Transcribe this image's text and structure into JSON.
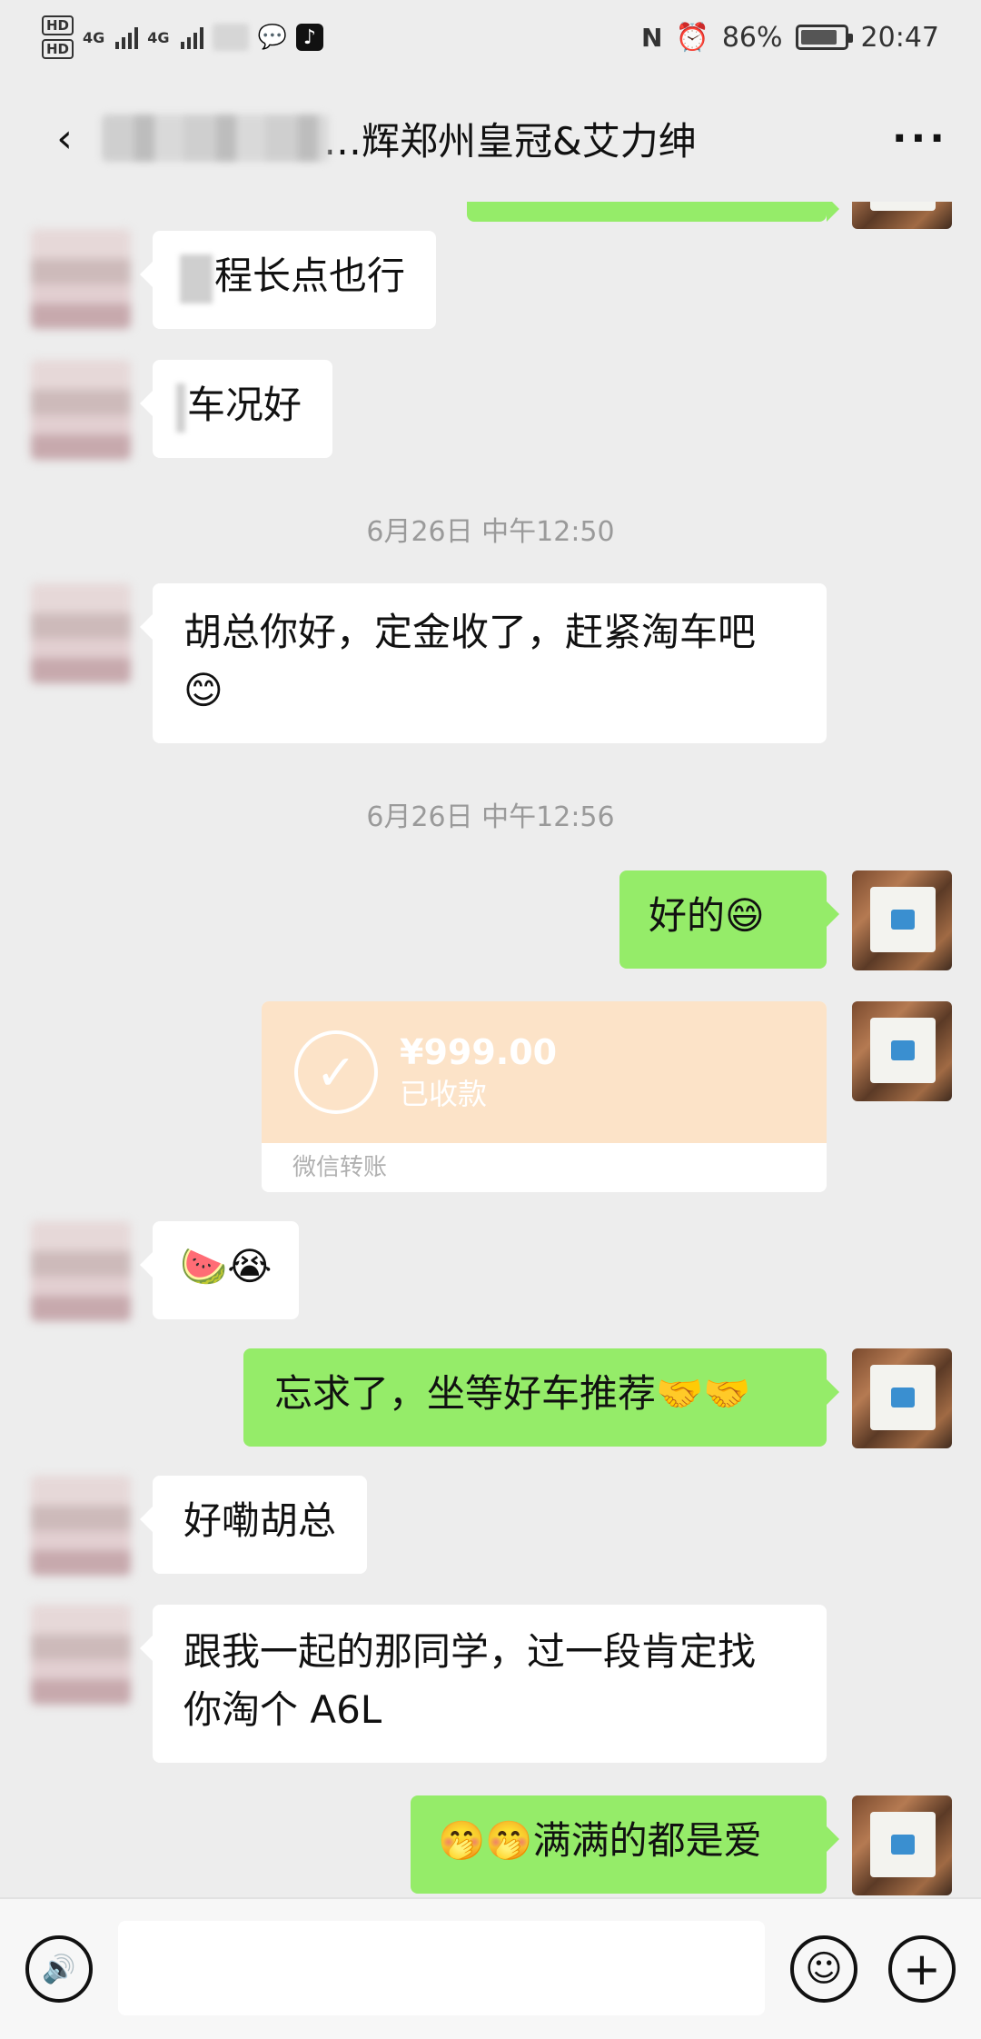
{
  "status_bar": {
    "hd1": "HD",
    "hd2": "HD",
    "net1": "4G",
    "net2": "4G",
    "nfc": "N",
    "alarm": "⏰",
    "battery": "86%",
    "battery_level": 0.86,
    "time": "20:47"
  },
  "header": {
    "back_icon": "back-arrow-icon",
    "title": "…辉郑州皇冠&艾力绅",
    "more_label": "···"
  },
  "messages": {
    "m1": "程长点也行",
    "m2": "车况好",
    "ts1": "6月26日 中午12:50",
    "m3_line1": "胡总你好，定金收了，赶紧淘车吧",
    "m3_emoji": "😊",
    "ts2": "6月26日 中午12:56",
    "m4_text": "好的",
    "m4_emoji": "😄",
    "transfer": {
      "amount": "¥999.00",
      "status": "已收款",
      "footer": "微信转账",
      "check": "✓"
    },
    "m5_emoji": "🍉😭",
    "m6_text": "忘求了，坐等好车推荐",
    "m6_emoji": "🤝🤝",
    "m7": "好嘞胡总",
    "m8_line1": "跟我一起的那同学，过一段肯定找",
    "m8_line2": "你淘个 A6L",
    "m9_emoji": "🤭🤭",
    "m9_text": "满满的都是爱"
  },
  "input_bar": {
    "voice_icon": "🔊",
    "emoji_icon": "☺",
    "plus_icon": "+"
  }
}
